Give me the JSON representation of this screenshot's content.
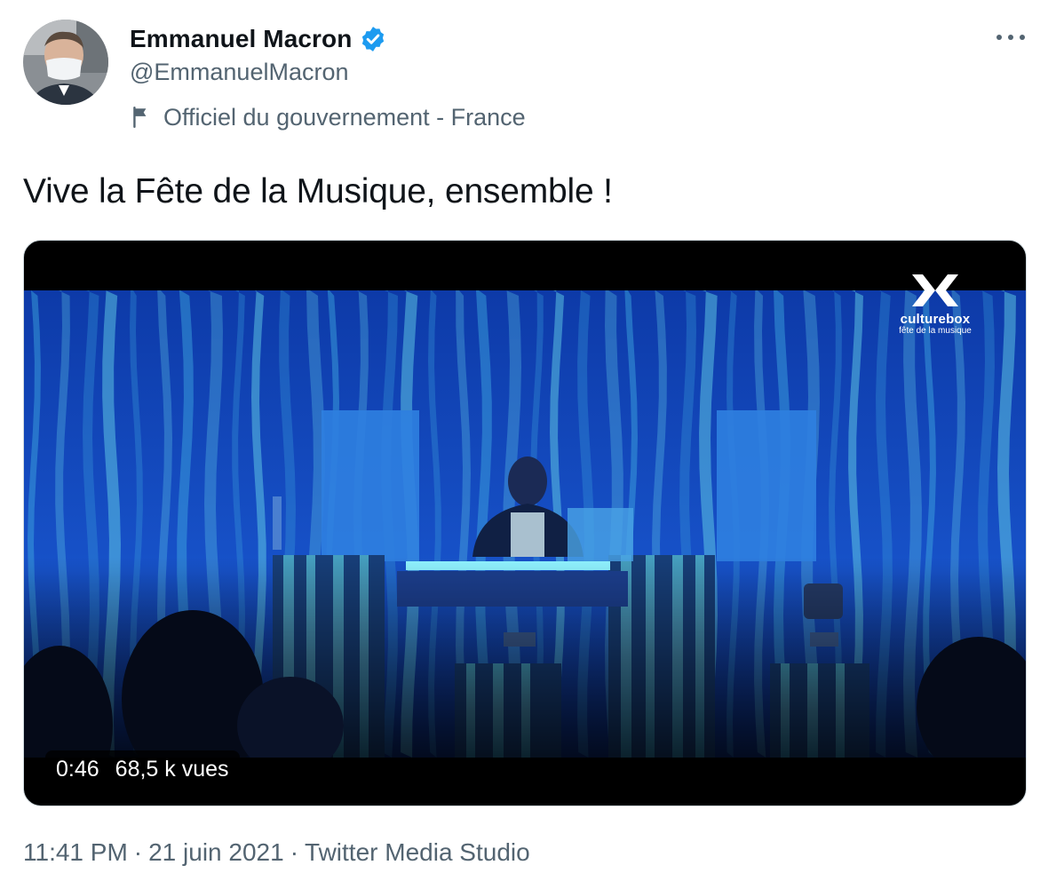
{
  "author": {
    "display_name": "Emmanuel Macron",
    "handle": "@EmmanuelMacron",
    "label": "Officiel du gouvernement - France",
    "avatar_icon": "profile-photo",
    "verified_icon": "verified-badge-icon",
    "verified_color": "#1d9bf0"
  },
  "tweet": {
    "text": "Vive la Fête de la Musique, ensemble !"
  },
  "media": {
    "type": "video",
    "duration": "0:46",
    "views": "68,5 k vues",
    "watermark": {
      "name": "culturebox",
      "subtitle": "fête de la musique"
    }
  },
  "meta": {
    "time": "11:41 PM",
    "separator": "·",
    "date": "21 juin 2021",
    "source": "Twitter Media Studio"
  },
  "colors": {
    "text_primary": "#0f1419",
    "text_secondary": "#536471",
    "border": "#cfd9de",
    "stage_blue": "#1a4fd0"
  }
}
